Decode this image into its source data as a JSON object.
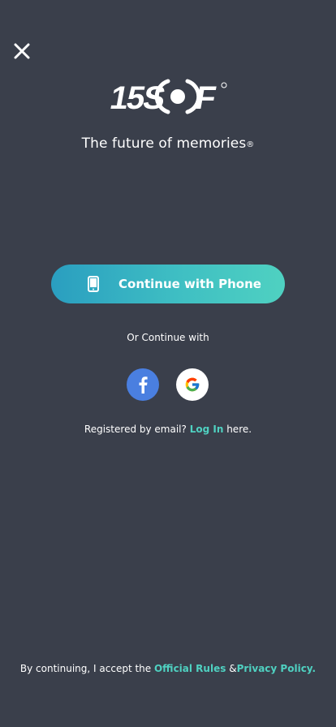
{
  "header": {
    "close_icon": "close-icon",
    "logo_text": "15SOF",
    "tagline": "The future of memories",
    "tagline_mark": "®"
  },
  "primary_action": {
    "label": "Continue with Phone",
    "icon": "phone-icon"
  },
  "alt_login": {
    "label": "Or Continue with",
    "providers": [
      {
        "name": "facebook",
        "icon": "facebook-icon",
        "color": "#4a7fe0"
      },
      {
        "name": "google",
        "icon": "google-icon",
        "color": "#ffffff"
      }
    ]
  },
  "email_login": {
    "prefix": "Registered by email?",
    "link": "Log In",
    "suffix": "here."
  },
  "footer": {
    "prefix": "By continuing, I accept the",
    "rules_link": "Official Rules",
    "separator": "&",
    "privacy_link": "Privacy Policy."
  },
  "colors": {
    "background": "#3a3f4b",
    "accent": "#4fd1c1",
    "gradient_start": "#2a9ec0",
    "gradient_end": "#4fd1c1"
  }
}
